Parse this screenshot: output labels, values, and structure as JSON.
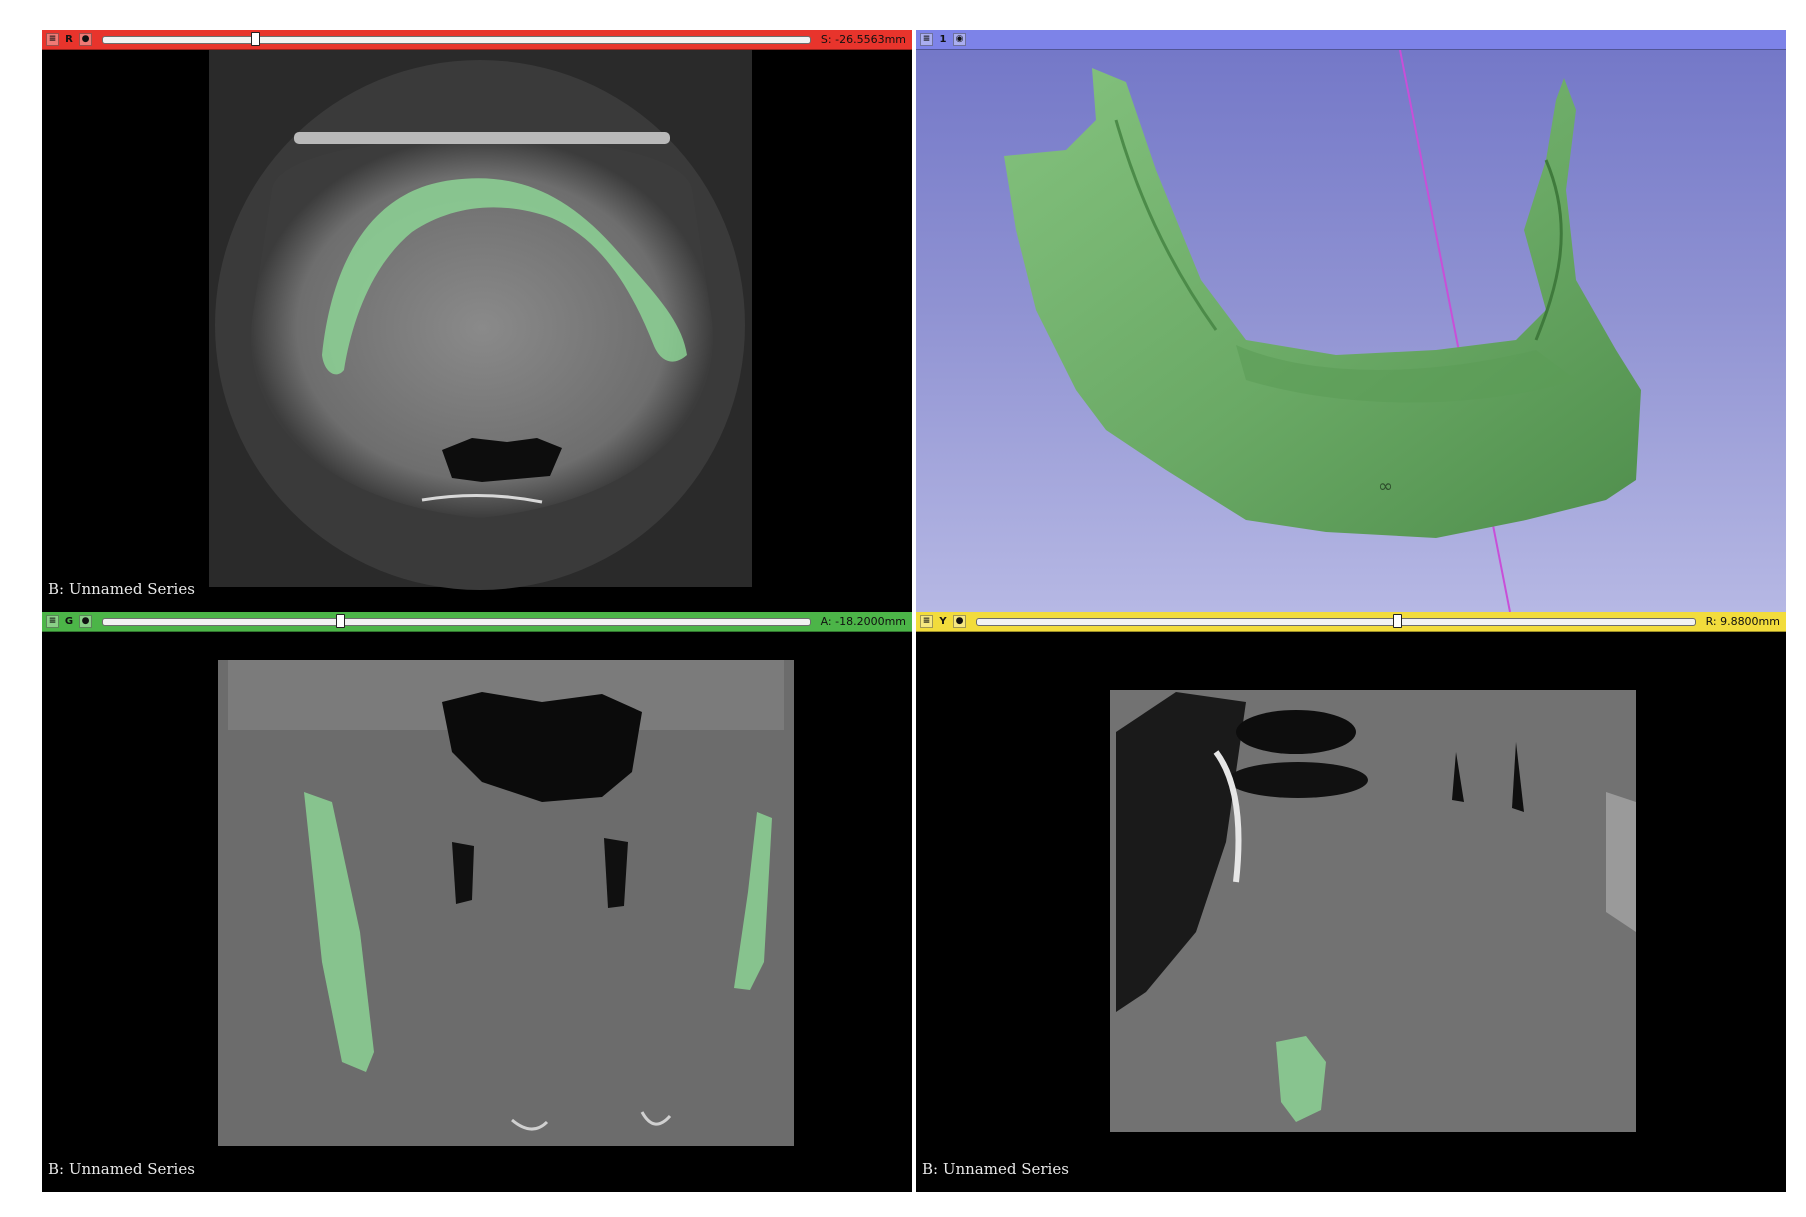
{
  "layout_name": "Four-Up",
  "colors": {
    "red_bar": "#e8342c",
    "blue_bar": "#7d83e8",
    "green_bar": "#4cb548",
    "yellow_bar": "#f2dc3c",
    "segment_fill": "#90e09a",
    "model_green": "#6fb26a"
  },
  "views": {
    "red": {
      "letter": "R",
      "offset_text": "S: -26.5563mm",
      "slider_fraction": 0.21,
      "series_label": "B: Unnamed Series",
      "icons": [
        "pin-icon",
        "link-icon"
      ]
    },
    "threed": {
      "letter": "1",
      "icons": [
        "pin-icon",
        "eye-icon"
      ]
    },
    "green": {
      "letter": "G",
      "offset_text": "A: -18.2000mm",
      "slider_fraction": 0.33,
      "series_label": "B: Unnamed Series",
      "icons": [
        "pin-icon",
        "link-icon"
      ]
    },
    "yellow": {
      "letter": "Y",
      "offset_text": "R: 9.8800mm",
      "slider_fraction": 0.58,
      "series_label": "B: Unnamed Series",
      "icons": [
        "pin-icon",
        "link-icon"
      ]
    }
  }
}
